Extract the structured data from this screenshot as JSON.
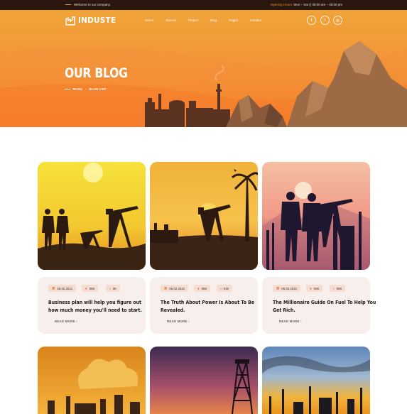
{
  "topbar": {
    "welcome": "Welcome to our company.",
    "hours_label": "Opening Hours:",
    "hours_value": "Mon – Sat (( 08:00 am – 05:00 pm"
  },
  "nav": {
    "brand": "INDUSTE",
    "menu": [
      "Home",
      "Service",
      "Project",
      "Blog",
      "Pages",
      "Contact"
    ],
    "social_icons": [
      "facebook-icon",
      "twitter-icon",
      "instagram-icon"
    ],
    "social_glyphs": [
      "f",
      "t",
      "◎"
    ]
  },
  "hero": {
    "title": "OUR BLOG",
    "breadcrumb": [
      "BLOG",
      "BLOG LIST"
    ]
  },
  "posts": [
    {
      "date": "05.02.2021",
      "likes": "05K",
      "comments": "3K",
      "title_line1": "Business plan will help you figure out",
      "title_line2": "how much money you'll need to start.",
      "read_more": "READ MORE"
    },
    {
      "date": "05.02.2021",
      "likes": "06K",
      "comments": "01K",
      "title_line1": "The Truth About Power Is About To Be",
      "title_line2": "Revealed.",
      "read_more": "READ MORE"
    },
    {
      "date": "05.02.2021",
      "likes": "03K",
      "comments": "05K",
      "title_line1": "The Millionaire Guide On Fuel To Help You",
      "title_line2": "Get Rich.",
      "read_more": "READ MORE"
    }
  ],
  "colors": {
    "accent": "#f08a1c",
    "dark": "#2a1710",
    "meta_bg": "#f6ddd2",
    "card_bg": "#f6efeb"
  }
}
